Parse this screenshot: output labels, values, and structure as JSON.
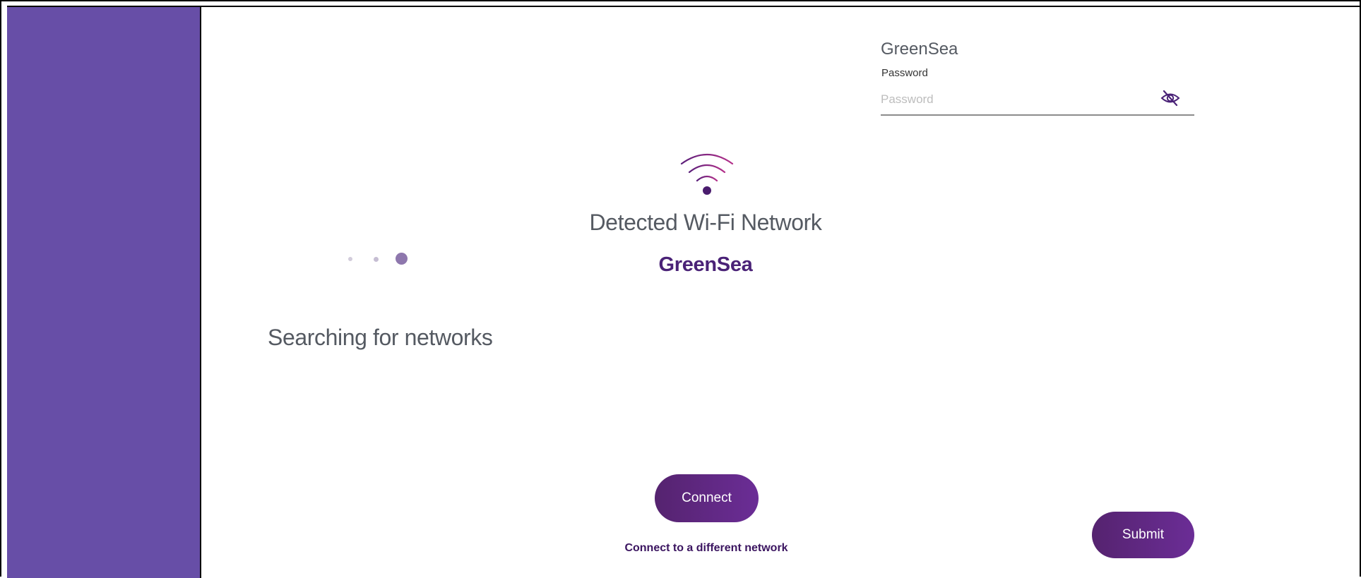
{
  "colors": {
    "sidebar": "#674ea7",
    "accent": "#6b2d96",
    "network_name": "#4a2277",
    "body_text": "#555a62"
  },
  "search_panel": {
    "status_text": "Searching for networks",
    "loader_icon": "loading-dots-icon"
  },
  "detected_panel": {
    "icon": "wifi-icon",
    "title": "Detected Wi-Fi Network",
    "network_name": "GreenSea",
    "connect_label": "Connect",
    "different_network_label": "Connect to a different network"
  },
  "password_panel": {
    "network_name": "GreenSea",
    "field_label": "Password",
    "field_placeholder": "Password",
    "field_value": "",
    "visibility_icon": "eye-slash-icon",
    "submit_label": "Submit"
  }
}
